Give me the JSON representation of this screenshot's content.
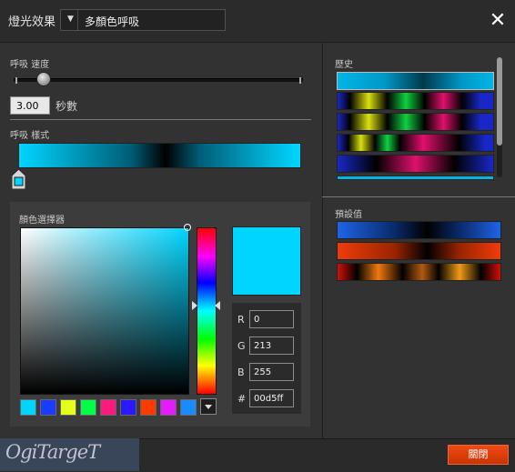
{
  "window": {
    "title": "燈光效果",
    "effect_value": "多顏色呼吸",
    "close_glyph": "✕"
  },
  "speed": {
    "label": "呼吸 速度",
    "value": "3.00",
    "unit": "秒數",
    "level": 0.1
  },
  "style": {
    "label": "呼吸 樣式"
  },
  "picker": {
    "label": "顏色選擇器",
    "current_color": "#00d5ff",
    "r_label": "R",
    "r": "0",
    "g_label": "G",
    "g": "213",
    "b_label": "B",
    "b": "255",
    "hex_label": "#",
    "hex": "00d5ff",
    "swatches": [
      "#00d5ff",
      "#1a3cff",
      "#e6ff1a",
      "#00ff46",
      "#ff1a82",
      "#2b1aff",
      "#ff3c00",
      "#e61aff",
      "#1a8cff"
    ]
  },
  "history": {
    "label": "歷史"
  },
  "presets": {
    "label": "預設值"
  },
  "footer": {
    "close_label": "關閉",
    "watermark": "OgiTargeT"
  },
  "colors": {
    "accent": "#e84a14",
    "background": "#323232"
  }
}
